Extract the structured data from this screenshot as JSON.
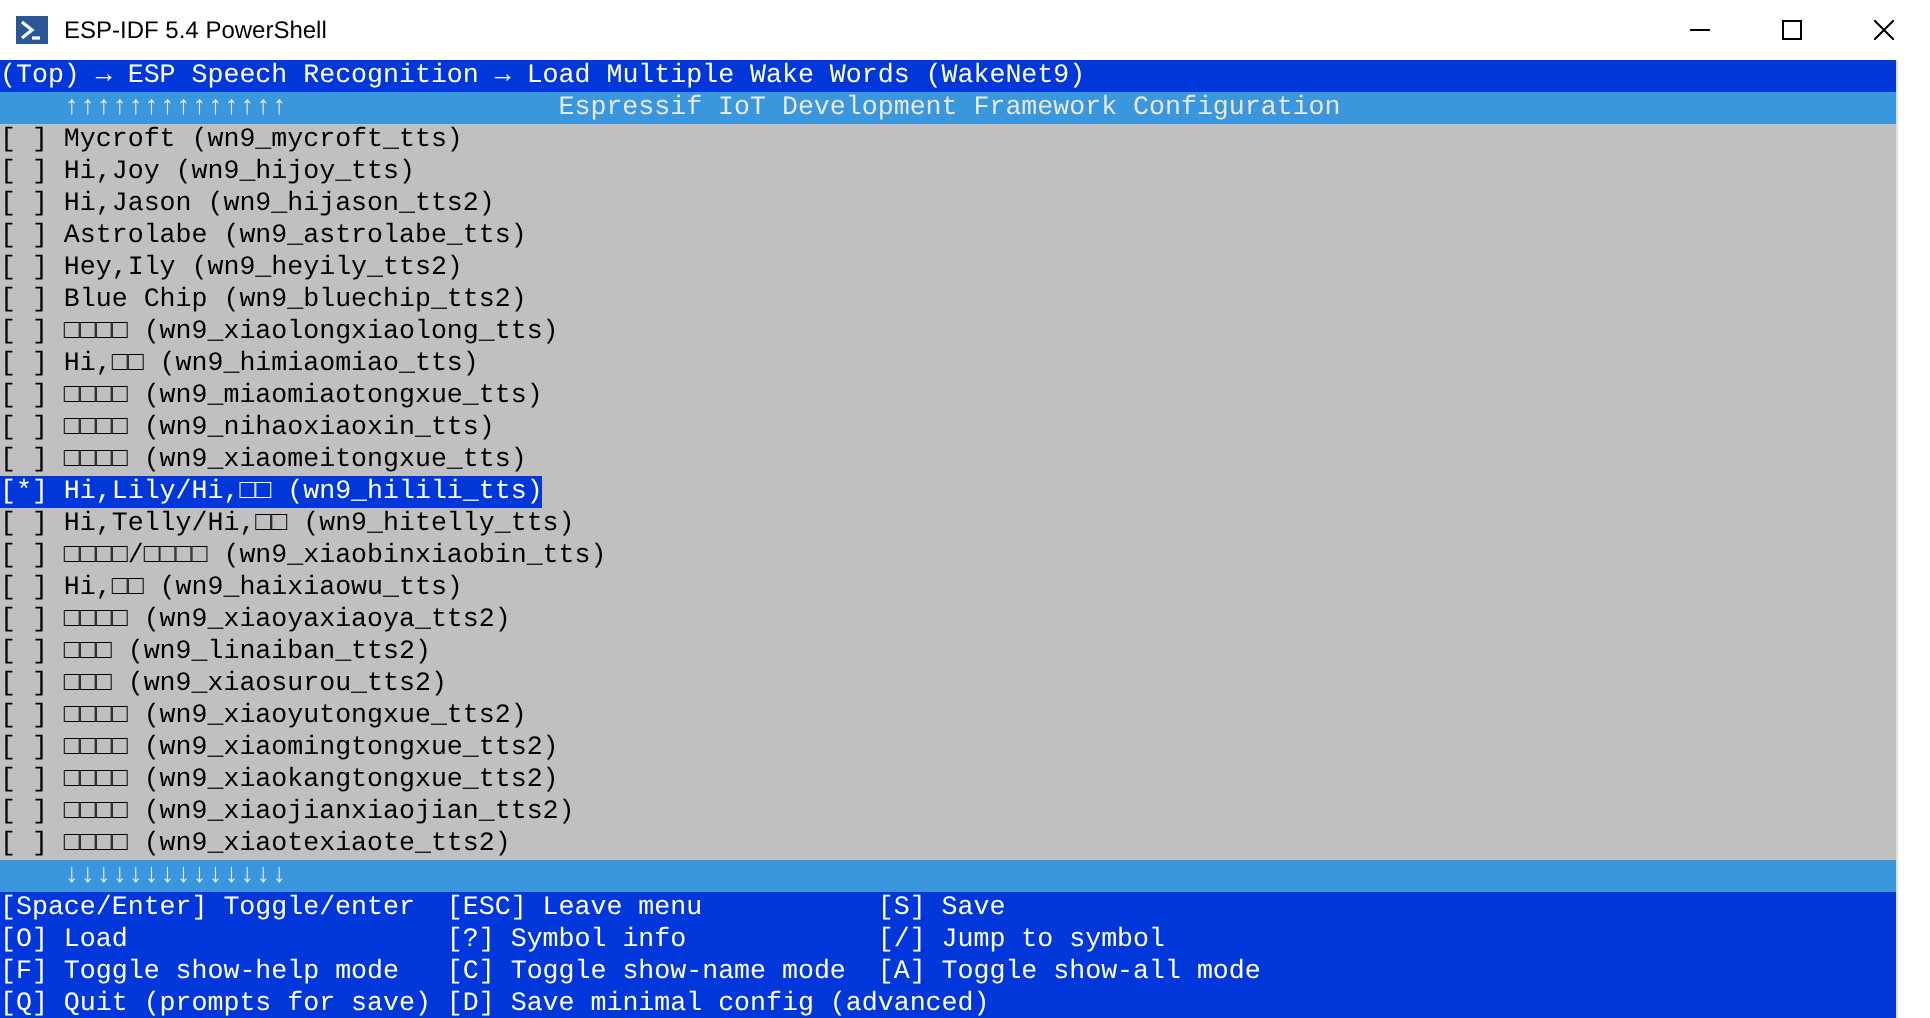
{
  "window": {
    "title": "ESP-IDF 5.4 PowerShell"
  },
  "breadcrumb": "(Top) → ESP Speech Recognition → Load Multiple Wake Words (WakeNet9)",
  "header": {
    "scroll_up": "↑↑↑↑↑↑↑↑↑↑↑↑↑↑",
    "title": "Espressif IoT Development Framework Configuration"
  },
  "items": [
    {
      "checkbox": "[ ]",
      "label": "Mycroft (wn9_mycroft_tts)",
      "selected": false
    },
    {
      "checkbox": "[ ]",
      "label": "Hi,Joy (wn9_hijoy_tts)",
      "selected": false
    },
    {
      "checkbox": "[ ]",
      "label": "Hi,Jason (wn9_hijason_tts2)",
      "selected": false
    },
    {
      "checkbox": "[ ]",
      "label": "Astrolabe (wn9_astrolabe_tts)",
      "selected": false
    },
    {
      "checkbox": "[ ]",
      "label": "Hey,Ily (wn9_heyily_tts2)",
      "selected": false
    },
    {
      "checkbox": "[ ]",
      "label": "Blue Chip (wn9_bluechip_tts2)",
      "selected": false
    },
    {
      "checkbox": "[ ]",
      "label": "□□□□ (wn9_xiaolongxiaolong_tts)",
      "selected": false
    },
    {
      "checkbox": "[ ]",
      "label": "Hi,□□ (wn9_himiaomiao_tts)",
      "selected": false
    },
    {
      "checkbox": "[ ]",
      "label": "□□□□ (wn9_miaomiaotongxue_tts)",
      "selected": false
    },
    {
      "checkbox": "[ ]",
      "label": "□□□□ (wn9_nihaoxiaoxin_tts)",
      "selected": false
    },
    {
      "checkbox": "[ ]",
      "label": "□□□□ (wn9_xiaomeitongxue_tts)",
      "selected": false
    },
    {
      "checkbox": "[*]",
      "label": "Hi,Lily/Hi,□□ (wn9_hilili_tts)",
      "selected": true
    },
    {
      "checkbox": "[ ]",
      "label": "Hi,Telly/Hi,□□ (wn9_hitelly_tts)",
      "selected": false
    },
    {
      "checkbox": "[ ]",
      "label": "□□□□/□□□□ (wn9_xiaobinxiaobin_tts)",
      "selected": false
    },
    {
      "checkbox": "[ ]",
      "label": "Hi,□□ (wn9_haixiaowu_tts)",
      "selected": false
    },
    {
      "checkbox": "[ ]",
      "label": "□□□□ (wn9_xiaoyaxiaoya_tts2)",
      "selected": false
    },
    {
      "checkbox": "[ ]",
      "label": "□□□ (wn9_linaiban_tts2)",
      "selected": false
    },
    {
      "checkbox": "[ ]",
      "label": "□□□ (wn9_xiaosurou_tts2)",
      "selected": false
    },
    {
      "checkbox": "[ ]",
      "label": "□□□□ (wn9_xiaoyutongxue_tts2)",
      "selected": false
    },
    {
      "checkbox": "[ ]",
      "label": "□□□□ (wn9_xiaomingtongxue_tts2)",
      "selected": false
    },
    {
      "checkbox": "[ ]",
      "label": "□□□□ (wn9_xiaokangtongxue_tts2)",
      "selected": false
    },
    {
      "checkbox": "[ ]",
      "label": "□□□□ (wn9_xiaojianxiaojian_tts2)",
      "selected": false
    },
    {
      "checkbox": "[ ]",
      "label": "□□□□ (wn9_xiaotexiaote_tts2)",
      "selected": false
    }
  ],
  "scroll_down": "↓↓↓↓↓↓↓↓↓↓↓↓↓↓",
  "shortcuts": [
    {
      "key": "[Space/Enter]",
      "action": "Toggle/enter"
    },
    {
      "key": "[ESC]",
      "action": "Leave menu"
    },
    {
      "key": "[S]",
      "action": "Save"
    },
    {
      "key": "[O]",
      "action": "Load"
    },
    {
      "key": "[?]",
      "action": "Symbol info"
    },
    {
      "key": "[/]",
      "action": "Jump to symbol"
    },
    {
      "key": "[F]",
      "action": "Toggle show-help mode"
    },
    {
      "key": "[C]",
      "action": "Toggle show-name mode"
    },
    {
      "key": "[A]",
      "action": "Toggle show-all mode"
    },
    {
      "key": "[Q]",
      "action": "Quit (prompts for save)"
    },
    {
      "key": "[D]",
      "action": "Save minimal config (advanced)"
    }
  ]
}
